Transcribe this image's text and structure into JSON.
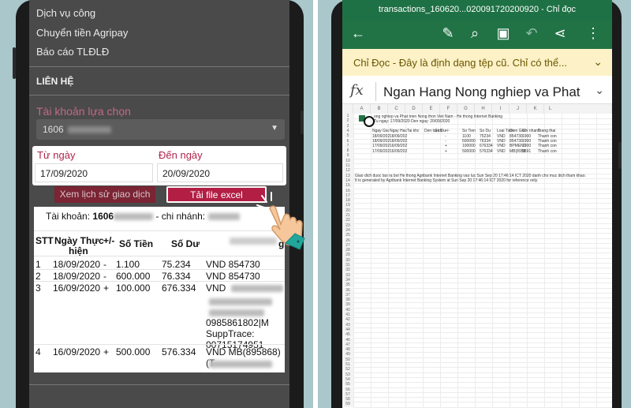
{
  "left_app": {
    "menu": [
      "Dịch vụ công",
      "Chuyển tiền Agripay",
      "Báo cáo TLĐLĐ"
    ],
    "contact_heading": "LIÊN HỆ",
    "account_label": "Tài khoản lựa chọn",
    "account_value": "1606",
    "from_label": "Từ ngày",
    "to_label": "Đến ngày",
    "from_value": "17/09/2020",
    "to_value": "20/09/2020",
    "history_button": "Xem lịch sử giao dịch",
    "excel_button": "Tải file excel",
    "account_line_prefix": "Tài khoản:",
    "account_line_number": "1606",
    "account_line_branch": "- chi nhánh:",
    "table_headers": {
      "stt": "STT",
      "date": "Ngày Thực",
      "date2": "hiện",
      "sign": "+/-",
      "amount": "Số Tiền",
      "balance": "Số Dư",
      "extra": "g"
    },
    "rows": [
      {
        "stt": "1",
        "date": "18/09/2020",
        "sign": "-",
        "amount": "1.100",
        "balance": "75.234",
        "desc": [
          "VND 854730"
        ]
      },
      {
        "stt": "2",
        "date": "18/09/2020",
        "sign": "-",
        "amount": "600.000",
        "balance": "76.334",
        "desc": [
          "VND 854730"
        ]
      },
      {
        "stt": "3",
        "date": "16/09/2020",
        "sign": "+",
        "amount": "100.000",
        "balance": "676.334",
        "desc": [
          "VND",
          "0985861802|M",
          "SuppTrace:",
          "00715174951"
        ]
      },
      {
        "stt": "4",
        "date": "16/09/2020",
        "sign": "+",
        "amount": "500.000",
        "balance": "576.334",
        "desc": [
          "VND MB(895868)(T"
        ]
      }
    ]
  },
  "right_app": {
    "title": "transactions_160620...020091720200920 - Chỉ đọc",
    "readonly_notice": "Chỉ Đọc - Đây là định dạng tệp cũ. Chỉ có thể...",
    "fx_label": "fx",
    "formula_text": "Ngan Hang Nong nghiep va Phat",
    "columns": [
      "A",
      "B",
      "C",
      "D",
      "E",
      "F",
      "G",
      "H",
      "I",
      "J",
      "K",
      "L"
    ],
    "cells": {
      "r1": "ong nghiep va Phat trien Nong thon Viet Nam - He thong Internet Banking",
      "r2": "Tu ngay: 17/09/2020 Den ngay: 20/09/2020",
      "r4": [
        "Ngay Gia",
        "Ngay Hac",
        "Tai khc",
        "Den tai kh",
        "So Du",
        "+/-",
        "So Tien",
        "So Du",
        "Loai Tien",
        "Dien Giai",
        "Chi nhanh",
        "Trang thai"
      ],
      "r5": [
        "18/09/202",
        "18/09/202",
        "",
        "",
        "",
        "-",
        "1100",
        "75234",
        "VND",
        "854730",
        "1900",
        "Thanh con"
      ],
      "r6": [
        "18/09/202",
        "18/09/202",
        "",
        "",
        "",
        "-",
        "600000",
        "76334",
        "VND",
        "854730",
        "1900",
        "Thanh con"
      ],
      "r7": [
        "17/09/202",
        "16/09/202",
        "",
        "",
        "",
        "+",
        "100000",
        "676334",
        "VND",
        "BPMENT",
        "1900",
        "Thanh con"
      ],
      "r8": [
        "17/09/202",
        "16/09/202",
        "",
        "",
        "",
        "+",
        "500000",
        "576334",
        "VND",
        "MB(8958",
        "5591",
        "Thanh con"
      ],
      "r13": "Giao dich duoc tao ra boi He thong Agribank Internet Banking vao luc Sun Sep 20 17:46:14 ICT 2020 danh cho muc dich tham khao.",
      "r14": "It is generated by Agribank Internet Banking System at Sun Sep 20 17:46:14 ICT 2020 for reference only."
    }
  },
  "colors": {
    "excel_green": "#217346",
    "agribank_red": "#b21e44",
    "background": "#aac7cb"
  }
}
